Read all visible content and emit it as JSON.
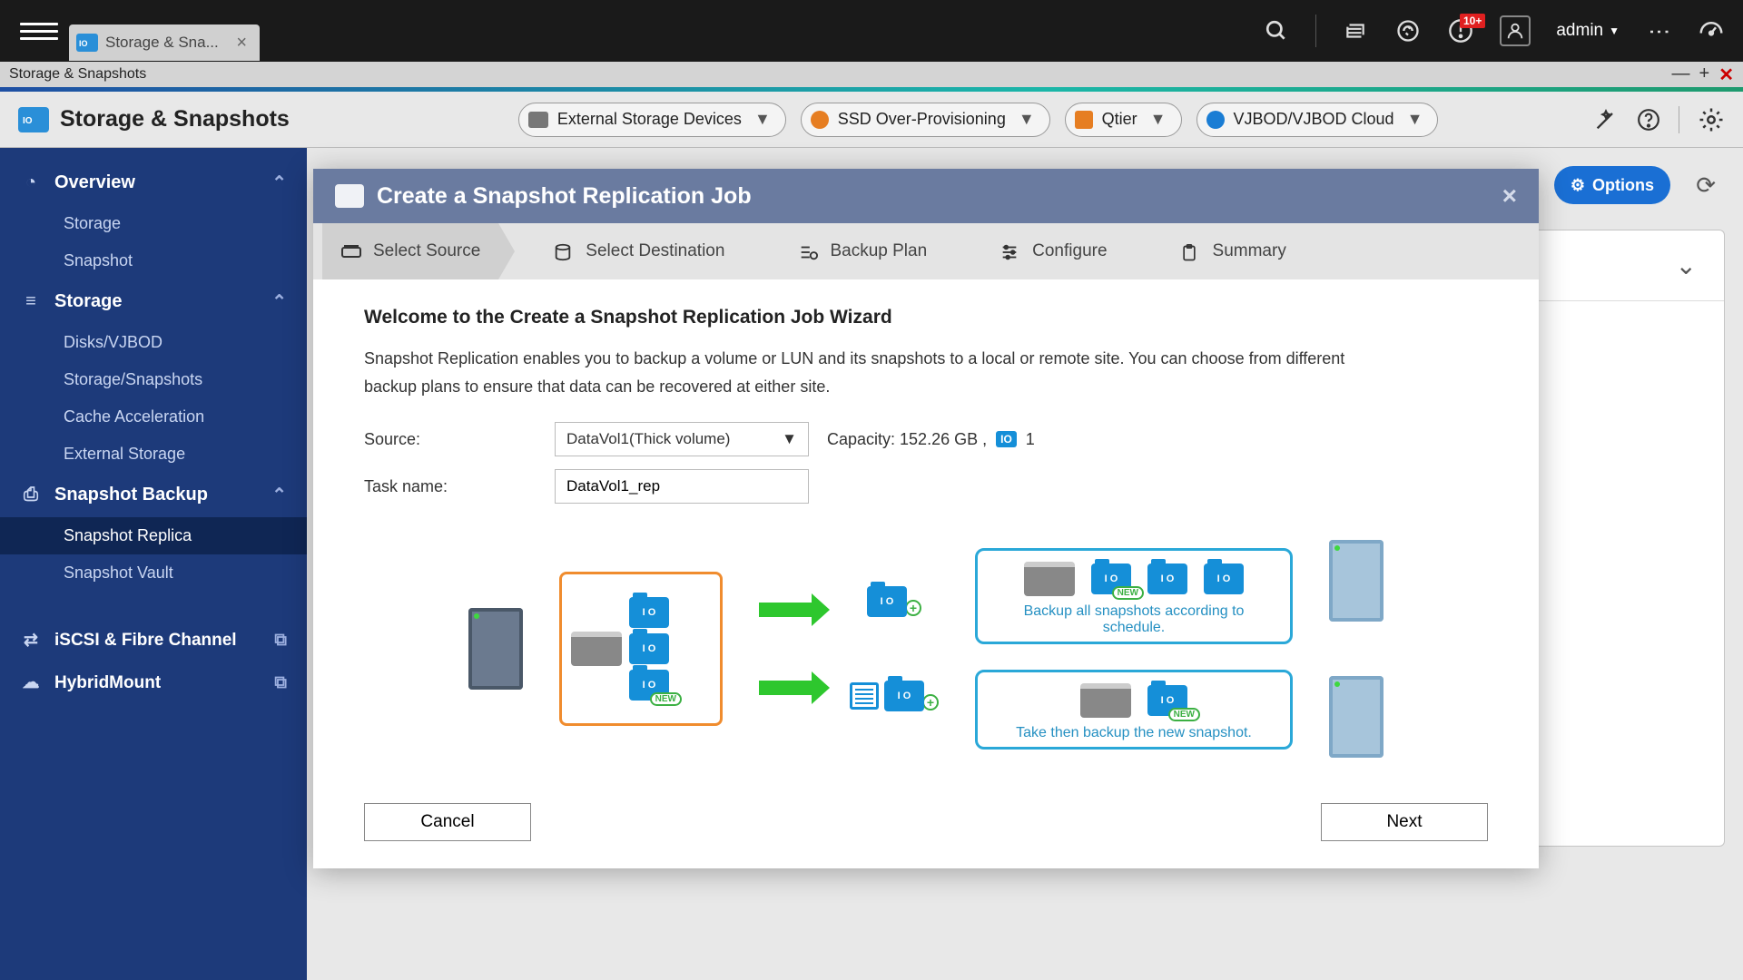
{
  "topbar": {
    "tab_title": "Storage & Sna...",
    "notif_badge": "10+",
    "user": "admin"
  },
  "winbar": {
    "title": "Storage & Snapshots"
  },
  "toolbar": {
    "title": "Storage & Snapshots",
    "ext_storage": "External Storage Devices",
    "ssd": "SSD Over-Provisioning",
    "qtier": "Qtier",
    "vjbod": "VJBOD/VJBOD Cloud"
  },
  "sidebar": {
    "overview": "Overview",
    "overview_items": [
      "Storage",
      "Snapshot"
    ],
    "storage": "Storage",
    "storage_items": [
      "Disks/VJBOD",
      "Storage/Snapshots",
      "Cache Acceleration",
      "External Storage"
    ],
    "snapshot_backup": "Snapshot Backup",
    "sb_items": [
      "Snapshot Replica",
      "Snapshot Vault"
    ],
    "iscsi": "iSCSI & Fibre Channel",
    "hybrid": "HybridMount"
  },
  "options_label": "Options",
  "modal": {
    "title": "Create a Snapshot Replication Job",
    "steps": [
      "Select Source",
      "Select Destination",
      "Backup Plan",
      "Configure",
      "Summary"
    ],
    "welcome": "Welcome to the Create a Snapshot Replication Job Wizard",
    "desc": "Snapshot Replication enables you to backup a volume or LUN and its snapshots to a local or remote site. You can choose from different backup plans to ensure that data can be recovered at either site.",
    "source_label": "Source:",
    "source_value": "DataVol1(Thick volume)",
    "capacity_label": "Capacity: 152.26 GB ,",
    "capacity_count": "1",
    "task_label": "Task name:",
    "task_value": "DataVol1_rep",
    "caption1": "Backup all snapshots according to schedule.",
    "caption2": "Take then backup the new snapshot.",
    "cancel": "Cancel",
    "next": "Next"
  }
}
